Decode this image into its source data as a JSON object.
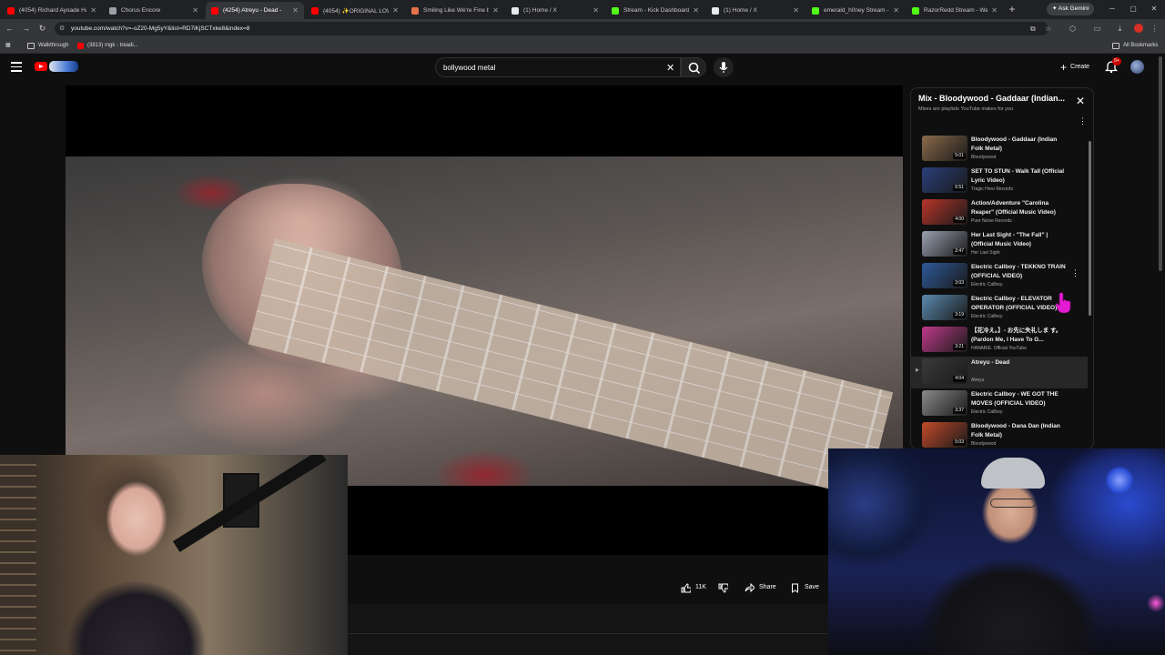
{
  "browser": {
    "tabs": [
      {
        "title": "(4054) Richard Ayoade Ha",
        "favicon_color": "#ff0000"
      },
      {
        "title": "Chorus Encore",
        "favicon_color": "#9aa0a6"
      },
      {
        "title": "(4254) Atreyu - Dead -",
        "favicon_color": "#ff0000",
        "active": true
      },
      {
        "title": "(4054) ✨ORIGINAL LOWP",
        "favicon_color": "#ff0000"
      },
      {
        "title": "Smiling Like We're Fine by",
        "favicon_color": "#e8704a"
      },
      {
        "title": "(1) Home / X",
        "favicon_color": "#e8eaed"
      },
      {
        "title": "Stream - Kick Dashboard",
        "favicon_color": "#53fc18"
      },
      {
        "title": "(1) Home / X",
        "favicon_color": "#e8eaed"
      },
      {
        "title": "emerald_h0ney Stream - W",
        "favicon_color": "#53fc18"
      },
      {
        "title": "RazorRedd Stream - Watch",
        "favicon_color": "#53fc18"
      }
    ],
    "gemini_label": "Ask Gemini",
    "url": "youtube.com/watch?v=-oZ20-Mg5yY&list=RD7iKjSCTxke8&index=8",
    "bookmarks": [
      {
        "label": "Walkthrough"
      },
      {
        "label": "(3813) mgk - treadi..."
      }
    ],
    "all_bookmarks_label": "All Bookmarks"
  },
  "youtube": {
    "search_value": "bollywood metal",
    "create_label": "Create",
    "notification_count": "9+",
    "actions": {
      "like_count": "11K",
      "share_label": "Share",
      "save_label": "Save"
    },
    "playlist": {
      "title": "Mix - Bloodywood - Gaddaar (Indian...",
      "subtitle": "Mixes are playlists YouTube makes for you",
      "items": [
        {
          "title": "Bloodywood - Gaddaar (Indian Folk Metal)",
          "channel": "Bloodywood",
          "duration": "5:01",
          "thumb": "#8a6a4a"
        },
        {
          "title": "SET TO STUN - Walk Tall (Official Lyric Video)",
          "channel": "Tragic Hero Records",
          "duration": "6:51",
          "thumb": "#2a3f7a"
        },
        {
          "title": "Action/Adventure \"Carolina Reaper\" (Official Music Video)",
          "channel": "Pure Noise Records",
          "duration": "4:00",
          "thumb": "#b8352a"
        },
        {
          "title": "Her Last Sight - \"The Fall\" | (Official Music Video)",
          "channel": "Her Last Sight",
          "duration": "2:47",
          "thumb": "#9aa0b0"
        },
        {
          "title": "Electric Callboy - TEKKNO TRAIN (OFFICIAL VIDEO)",
          "channel": "Electric Callboy",
          "duration": "3:03",
          "thumb": "#2e5a9a"
        },
        {
          "title": "Electric Callboy - ELEVATOR OPERATOR (OFFICIAL VIDEO)",
          "channel": "Electric Callboy",
          "duration": "3:19",
          "thumb": "#5a8ab0"
        },
        {
          "title": "【花冷え。】- お先に失礼しま す。 (Pardon Me, I Have To G...",
          "channel": "HANABIE. Official YouTube",
          "duration": "3:21",
          "thumb": "#c03a8a"
        },
        {
          "title": "Atreyu - Dead",
          "channel": "Atreyu",
          "duration": "4:04",
          "thumb": "#3a3a3a",
          "current": true
        },
        {
          "title": "Electric Callboy - WE GOT THE MOVES (OFFICIAL VIDEO)",
          "channel": "Electric Callboy",
          "duration": "3:37",
          "thumb": "#8a8a8a"
        },
        {
          "title": "Bloodywood - Dana Dan (Indian Folk Metal)",
          "channel": "Bloodywood",
          "duration": "5:03",
          "thumb": "#c24a2a"
        }
      ]
    }
  }
}
